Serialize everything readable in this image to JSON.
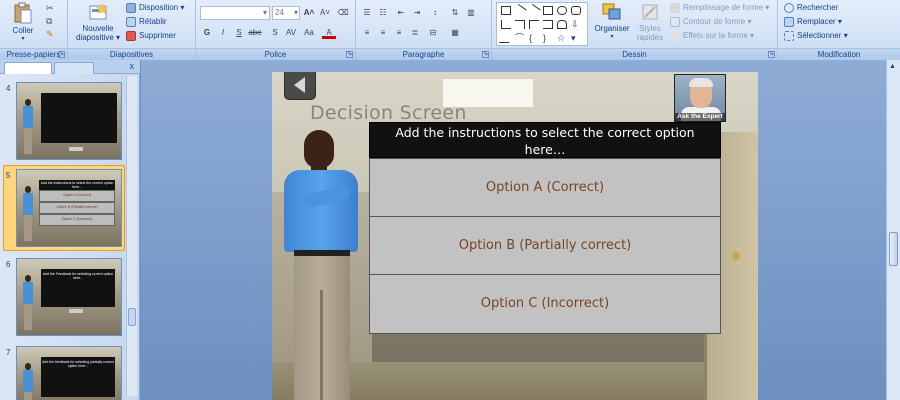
{
  "ribbon": {
    "clipboard": {
      "paste": "Coller",
      "label": "Presse-papiers"
    },
    "slides": {
      "new_slide_line1": "Nouvelle",
      "new_slide_line2": "diapositive",
      "layout": "Disposition",
      "reset": "Rétablir",
      "delete": "Supprimer",
      "label": "Diapositives"
    },
    "font": {
      "size": "24",
      "label": "Police"
    },
    "paragraph": {
      "label": "Paragraphe"
    },
    "drawing": {
      "arrange": "Organiser",
      "quick_styles_line1": "Styles",
      "quick_styles_line2": "rapides",
      "shape_fill": "Remplissage de forme",
      "shape_outline": "Contour de forme",
      "shape_effects": "Effets sur la forme",
      "label": "Dessin"
    },
    "editing": {
      "find": "Rechercher",
      "replace": "Remplacer",
      "select": "Sélectionner",
      "label": "Modification"
    }
  },
  "slides_panel": {
    "close": "x",
    "thumbnails": [
      {
        "number": "4"
      },
      {
        "number": "5",
        "selected": true,
        "title": "Add the instructions to select the correct option here...",
        "options": [
          "Option A (Correct)",
          "Option B (Partially correct)",
          "Option C (Incorrect)"
        ]
      },
      {
        "number": "6",
        "title": "Add the Feedback for selecting correct option here..."
      },
      {
        "number": "7",
        "title": "Add the feedback for selecting partially correct option here..."
      }
    ]
  },
  "slide": {
    "title": "Decision Screen",
    "question": "Add the instructions to select the correct option here…",
    "expert_label": "Ask the Expert",
    "options": [
      "Option A (Correct)",
      "Option B (Partially correct)",
      "Option C (Incorrect)"
    ]
  },
  "colors": {
    "ribbon": "#d6e4f7",
    "option_text": "#7a4422",
    "selection": "#ffd57a",
    "question_bg": "#111111"
  }
}
